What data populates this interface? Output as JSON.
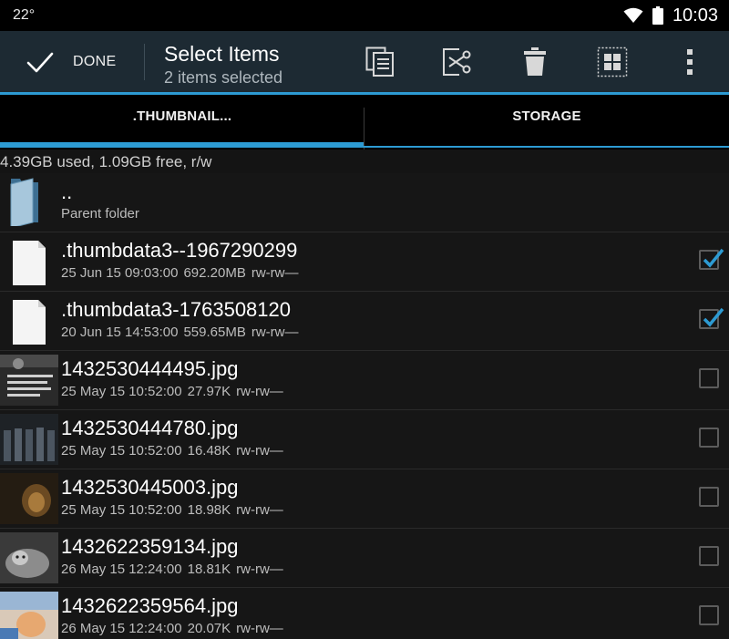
{
  "status_bar": {
    "temperature": "22°",
    "time": "10:03"
  },
  "action_bar": {
    "done_label": "DONE",
    "title": "Select Items",
    "subtitle": "2 items selected",
    "actions": [
      "copy-icon",
      "cut-icon",
      "delete-icon",
      "select-all-icon",
      "overflow-menu-icon"
    ]
  },
  "tabs": [
    {
      "label": ".THUMBNAIL...",
      "active": true
    },
    {
      "label": "STORAGE",
      "active": false
    }
  ],
  "storage_info": "4.39GB used, 1.09GB free, r/w",
  "parent": {
    "name": "..",
    "subtitle": "Parent folder"
  },
  "files": [
    {
      "name": ".thumbdata3--1967290299",
      "date": "25 Jun 15 09:03:00",
      "size": "692.20MB",
      "perms": "rw-rw—",
      "checked": true,
      "thumb": "doc"
    },
    {
      "name": ".thumbdata3-1763508120",
      "date": "20 Jun 15 14:53:00",
      "size": "559.65MB",
      "perms": "rw-rw—",
      "checked": true,
      "thumb": "doc"
    },
    {
      "name": "1432530444495.jpg",
      "date": "25 May 15 10:52:00",
      "size": "27.97K",
      "perms": "rw-rw—",
      "checked": false,
      "thumb": "img1"
    },
    {
      "name": "1432530444780.jpg",
      "date": "25 May 15 10:52:00",
      "size": "16.48K",
      "perms": "rw-rw—",
      "checked": false,
      "thumb": "img2"
    },
    {
      "name": "1432530445003.jpg",
      "date": "25 May 15 10:52:00",
      "size": "18.98K",
      "perms": "rw-rw—",
      "checked": false,
      "thumb": "img3"
    },
    {
      "name": "1432622359134.jpg",
      "date": "26 May 15 12:24:00",
      "size": "18.81K",
      "perms": "rw-rw—",
      "checked": false,
      "thumb": "img4"
    },
    {
      "name": "1432622359564.jpg",
      "date": "26 May 15 12:24:00",
      "size": "20.07K",
      "perms": "rw-rw—",
      "checked": false,
      "thumb": "img5"
    }
  ],
  "colors": {
    "accent": "#2d9bd3",
    "actionbar": "#1d2a33",
    "background": "#141414"
  }
}
